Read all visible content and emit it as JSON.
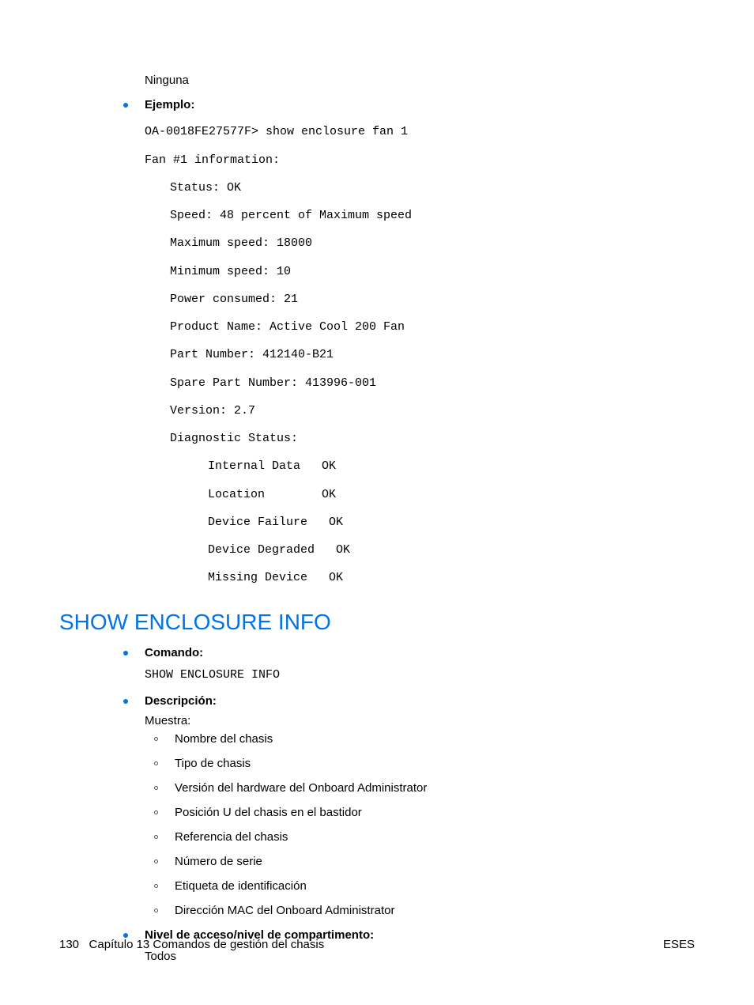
{
  "top_text": "Ninguna",
  "ejemplo_label": "Ejemplo:",
  "code": {
    "l1": "OA-0018FE27577F> show enclosure fan 1",
    "l2": "Fan #1 information:",
    "l3": "Status: OK",
    "l4": "Speed: 48 percent of Maximum speed",
    "l5": "Maximum speed: 18000",
    "l6": "Minimum speed: 10",
    "l7": "Power consumed: 21",
    "l8": "Product Name: Active Cool 200 Fan",
    "l9": "Part Number: 412140-B21",
    "l10": "Spare Part Number: 413996-001",
    "l11": "Version: 2.7",
    "l12": "Diagnostic Status:",
    "l13": "Internal Data   OK",
    "l14": "Location        OK",
    "l15": "Device Failure   OK",
    "l16": "Device Degraded   OK",
    "l17": "Missing Device   OK"
  },
  "section_title": "SHOW ENCLOSURE INFO",
  "comando_label": "Comando:",
  "comando_value": "SHOW ENCLOSURE INFO",
  "descripcion_label": "Descripción:",
  "descripcion_intro": "Muestra:",
  "desc_items": {
    "d0": "Nombre del chasis",
    "d1": "Tipo de chasis",
    "d2": "Versión del hardware del Onboard Administrator",
    "d3": "Posición U del chasis en el bastidor",
    "d4": "Referencia del chasis",
    "d5": "Número de serie",
    "d6": "Etiqueta de identificación",
    "d7": "Dirección MAC del Onboard Administrator"
  },
  "nivel_label": "Nivel de acceso/nivel de compartimento:",
  "nivel_value": "Todos",
  "footer": {
    "page_num": "130",
    "chapter": "Capítulo 13   Comandos de gestión del chasis",
    "right": "ESES"
  }
}
